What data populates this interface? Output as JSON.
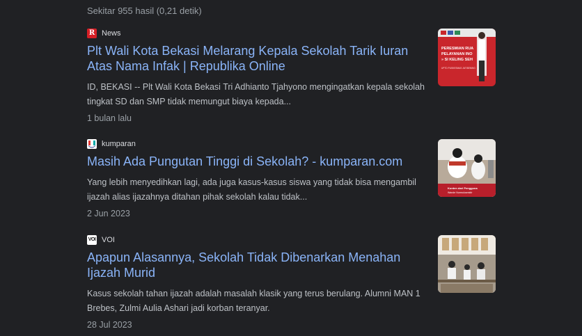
{
  "stats": "Sekitar 955 hasil (0,21 detik)",
  "results": [
    {
      "source": "News",
      "favicon": "republika-icon",
      "title": "Plt Wali Kota Bekasi Melarang Kepala Sekolah Tarik Iuran Atas Nama Infak | Republika Online",
      "snippet": "ID, BEKASI -- Plt Wali Kota Bekasi Tri Adhianto Tjahyono mengingatkan kepala sekolah tingkat SD dan SMP tidak memungut biaya kepada...",
      "date": "1 bulan lalu",
      "thumbnail_text": [
        "PERESMIAN RUA",
        "PELAYANAN INO",
        "» SI KELING SEH",
        "UPTD PUSKESMAS JATIBENING"
      ]
    },
    {
      "source": "kumparan",
      "favicon": "kumparan-icon",
      "title": "Masih Ada Pungutan Tinggi di Sekolah? - kumparan.com",
      "snippet": "Yang lebih menyedihkan lagi, ada juga kasus-kasus siswa yang tidak bisa mengambil ijazah alias ijazahnya ditahan pihak sekolah kalau tidak...",
      "date": "2 Jun 2023",
      "thumbnail_text": [
        "Konten dari Pengguna",
        "Wande Nurmulusmidir"
      ]
    },
    {
      "source": "VOI",
      "favicon": "voi-icon",
      "title": "Apapun Alasannya, Sekolah Tidak Dibenarkan Menahan Ijazah Murid",
      "snippet": "Kasus sekolah tahan ijazah adalah masalah klasik yang terus berulang. Alumni MAN 1 Brebes, Zulmi Aulia Ashari jadi korban teranyar.",
      "date": "28 Jul 2023",
      "thumbnail_text": []
    }
  ]
}
